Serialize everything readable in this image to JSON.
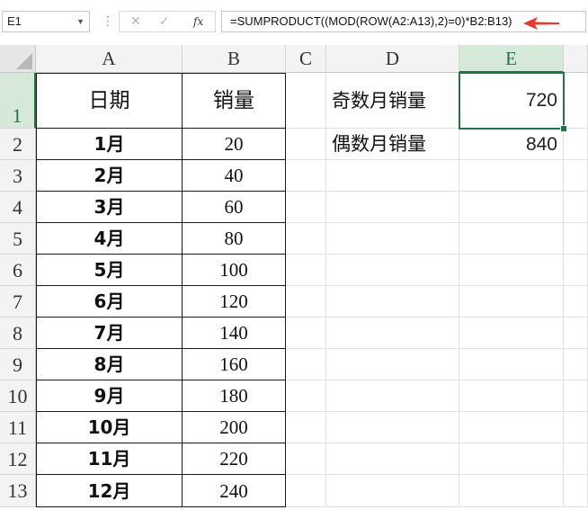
{
  "namebox": {
    "value": "E1"
  },
  "formula_bar": {
    "fx_label": "fx",
    "formula": "=SUMPRODUCT((MOD(ROW(A2:A13),2)=0)*B2:B13)"
  },
  "columns": [
    "A",
    "B",
    "C",
    "D",
    "E"
  ],
  "rows": [
    "1",
    "2",
    "3",
    "4",
    "5",
    "6",
    "7",
    "8",
    "9",
    "10",
    "11",
    "12",
    "13"
  ],
  "sheet": {
    "header": {
      "a": "日期",
      "b": "销量"
    },
    "data": [
      {
        "a": "1月",
        "b": "20"
      },
      {
        "a": "2月",
        "b": "40"
      },
      {
        "a": "3月",
        "b": "60"
      },
      {
        "a": "4月",
        "b": "80"
      },
      {
        "a": "5月",
        "b": "100"
      },
      {
        "a": "6月",
        "b": "120"
      },
      {
        "a": "7月",
        "b": "140"
      },
      {
        "a": "8月",
        "b": "160"
      },
      {
        "a": "9月",
        "b": "180"
      },
      {
        "a": "10月",
        "b": "200"
      },
      {
        "a": "11月",
        "b": "220"
      },
      {
        "a": "12月",
        "b": "240"
      }
    ],
    "summary": [
      {
        "label": "奇数月销量",
        "value": "720"
      },
      {
        "label": "偶数月销量",
        "value": "840"
      }
    ]
  },
  "colors": {
    "accent": "#217346",
    "arrow": "#e8392b"
  }
}
